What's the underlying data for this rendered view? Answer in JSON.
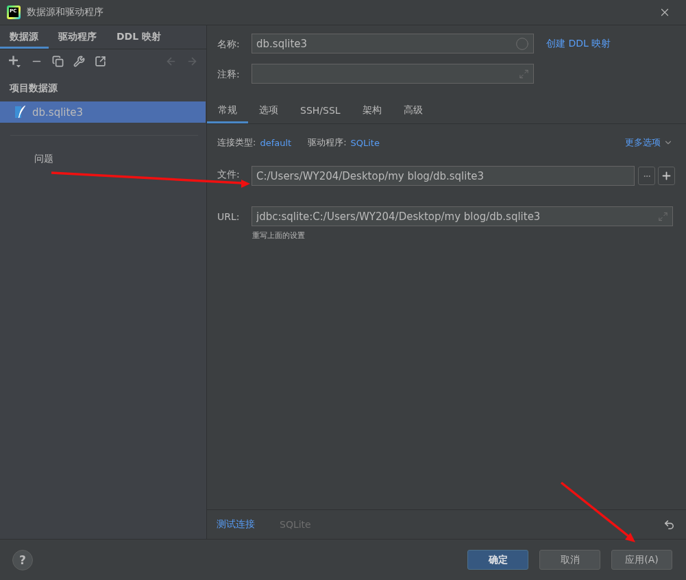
{
  "window": {
    "title": "数据源和驱动程序",
    "logo_text": "PC"
  },
  "sidebar": {
    "tabs": [
      {
        "label": "数据源",
        "selected": true
      },
      {
        "label": "驱动程序",
        "selected": false
      },
      {
        "label": "DDL 映射",
        "selected": false
      }
    ],
    "toolbar": [
      {
        "kind": "add",
        "disabled": false
      },
      {
        "kind": "remove",
        "disabled": false
      },
      {
        "kind": "duplicate",
        "disabled": false
      },
      {
        "kind": "properties",
        "disabled": false
      },
      {
        "kind": "jump",
        "disabled": false
      },
      {
        "kind": "back",
        "disabled": true
      },
      {
        "kind": "forward",
        "disabled": true
      }
    ],
    "section_title": "项目数据源",
    "items": [
      {
        "label": "db.sqlite3",
        "selected": true
      }
    ],
    "problems": "问题"
  },
  "form": {
    "name": {
      "label": "名称:",
      "value": "db.sqlite3"
    },
    "create_ddl_link": "创建 DDL 映射",
    "comment": {
      "label": "注释:"
    },
    "tabs": [
      {
        "label": "常规",
        "selected": true
      },
      {
        "label": "选项",
        "selected": false
      },
      {
        "label": "SSH/SSL",
        "selected": false
      },
      {
        "label": "架构",
        "selected": false
      },
      {
        "label": "高级",
        "selected": false
      }
    ],
    "connection_type": {
      "label": "连接类型:",
      "value": "default"
    },
    "driver": {
      "label": "驱动程序:",
      "value": "SQLite"
    },
    "more_options": "更多选项",
    "file": {
      "label": "文件:",
      "value": "C:/Users/WY204/Desktop/my blog/db.sqlite3"
    },
    "url": {
      "label": "URL:",
      "value": "jdbc:sqlite:C:/Users/WY204/Desktop/my blog/db.sqlite3",
      "hint": "重写上面的设置"
    }
  },
  "status": {
    "test_connection": "测试连接",
    "driver_name": "SQLite"
  },
  "footer": {
    "help": "?",
    "buttons": [
      {
        "label": "确定",
        "kind": "primary"
      },
      {
        "label": "取消",
        "kind": "secondary"
      },
      {
        "label": "应用(A)",
        "kind": "secondary"
      }
    ]
  }
}
